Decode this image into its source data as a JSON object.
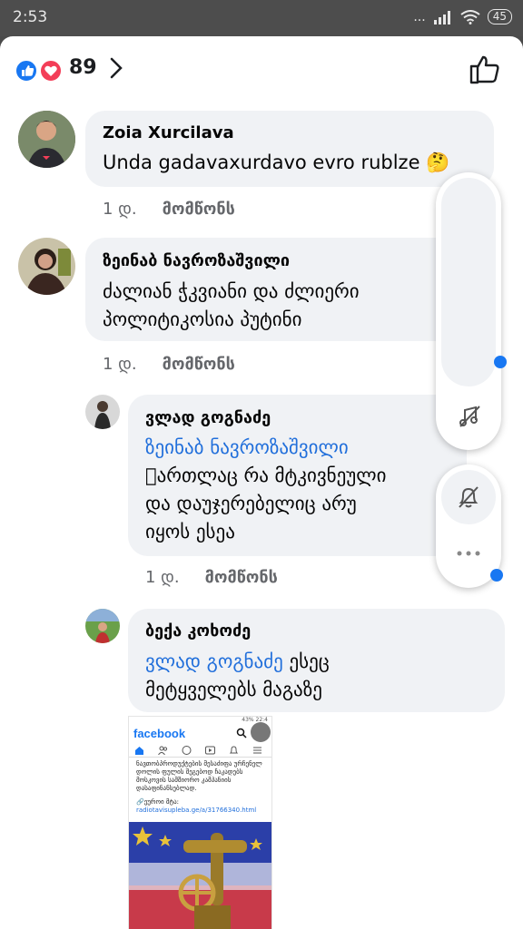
{
  "status_bar": {
    "time": "2:53",
    "signal": "...",
    "battery": "45"
  },
  "header": {
    "reaction_count": "89"
  },
  "comments": [
    {
      "author": "Zoia Xurcilava",
      "text": "Unda gadavaxurdavo evro rublze 🤔",
      "time": "1 დ.",
      "like_label": "მომწონს"
    },
    {
      "author": "ზეინაბ ნავროზაშვილი",
      "text_line1": "ძალიან ჭკვიანი და ძლიერი",
      "text_line2": "პოლიტიკოსია პუტინი",
      "time": "1 დ.",
      "like_label": "მომწონს"
    },
    {
      "author": "ვლად გოგნაძე",
      "mention": "ზეინაბ ნავროზაშვილი",
      "text_line1": "\u0000ართლაც რა მტკივნეული",
      "text_line2": "და დაუჯერებელიც არუ",
      "text_line3": "იყოს ესეა",
      "time": "1 დ.",
      "like_label": "მომწონს"
    },
    {
      "author": "ბექა კოხოძე",
      "mention": "ვლად გოგნაძე",
      "text_after_mention": " ესეც",
      "text_line2": "მეტყველებს მაგაზე"
    }
  ],
  "attachment": {
    "app_name": "facebook",
    "status": "43% 22:4",
    "body": "ნავთობპროდუქტების მესაძიფა ურჩენელ დოლის ფულის შეგებოდ ჩაკადებს მოსკოვის სამშიორო კამპანიის დასაფინანსებლად.",
    "link_prefix": "🔗ეუროი მტა: ",
    "link": "radiotavisupleba.ge/a/31766340.html"
  },
  "icons": [
    "like-reaction-icon",
    "love-reaction-icon",
    "chevron-right-icon",
    "thumbs-up-icon",
    "music-off-icon",
    "bell-off-icon",
    "more-icon"
  ],
  "colors": {
    "accent": "#1877f2",
    "bubble": "#f0f2f5",
    "mention": "#216fdb",
    "love": "#f33e58"
  }
}
